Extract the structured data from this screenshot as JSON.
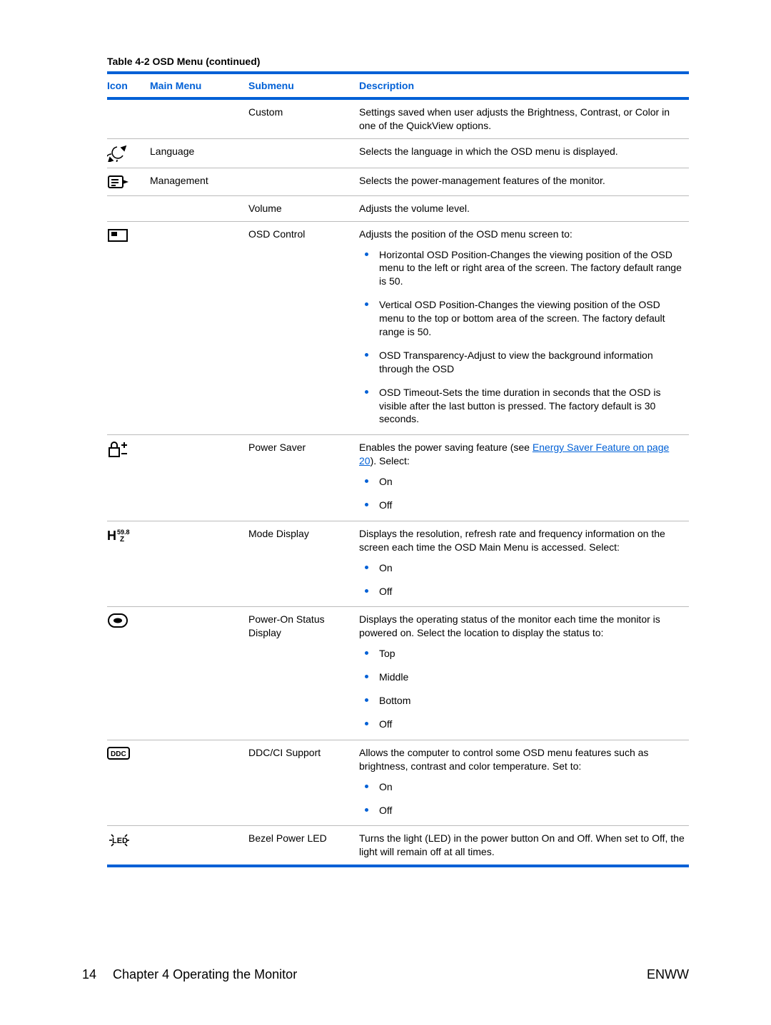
{
  "caption_prefix": "Table 4-2",
  "caption_rest": "  OSD Menu (continued)",
  "headers": {
    "icon": "Icon",
    "main": "Main Menu",
    "sub": "Submenu",
    "desc": "Description"
  },
  "rows": {
    "custom": {
      "sub": "Custom",
      "desc": "Settings saved when user adjusts the Brightness, Contrast, or Color in one of the QuickView options."
    },
    "language": {
      "main": "Language",
      "desc": "Selects the language in which the OSD menu is displayed."
    },
    "management": {
      "main": "Management",
      "desc": "Selects the power-management features of the monitor."
    },
    "volume": {
      "sub": "Volume",
      "desc": "Adjusts the volume level."
    },
    "osdcontrol": {
      "sub": "OSD Control",
      "desc": "Adjusts the position of the OSD menu screen to:",
      "bullets": [
        "Horizontal OSD Position-Changes the viewing position of the OSD menu to the left or right area of the screen. The factory default range is 50.",
        "Vertical OSD Position-Changes the viewing position of the OSD menu to the top or bottom area of the screen. The factory default range is 50.",
        "OSD Transparency-Adjust to view the background information through the OSD",
        "OSD Timeout-Sets the time duration in seconds that the OSD is visible after the last button is pressed. The factory default is 30 seconds."
      ]
    },
    "powersaver": {
      "sub": "Power Saver",
      "desc_before": "Enables the power saving feature (see ",
      "link_text": "Energy Saver Feature on page 20",
      "desc_after": "). Select:",
      "bullets": [
        "On",
        "Off"
      ]
    },
    "modedisplay": {
      "sub": "Mode Display",
      "desc": "Displays the resolution, refresh rate and frequency information on the screen each time the OSD Main Menu is accessed. Select:",
      "bullets": [
        "On",
        "Off"
      ]
    },
    "poweron": {
      "sub": "Power-On Status Display",
      "desc": "Displays the operating status of the monitor each time the monitor is powered on. Select the location to display the status to:",
      "bullets": [
        "Top",
        "Middle",
        "Bottom",
        "Off"
      ]
    },
    "ddcci": {
      "sub": "DDC/CI Support",
      "desc": "Allows the computer to control some OSD menu features such as brightness, contrast and color temperature. Set to:",
      "bullets": [
        "On",
        "Off"
      ]
    },
    "bezel": {
      "sub": "Bezel Power LED",
      "desc": "Turns the light (LED) in the power button On and Off. When set to Off, the light will remain off at all times."
    }
  },
  "footer": {
    "page": "14",
    "chapter": "Chapter 4   Operating the Monitor",
    "right": "ENWW"
  }
}
